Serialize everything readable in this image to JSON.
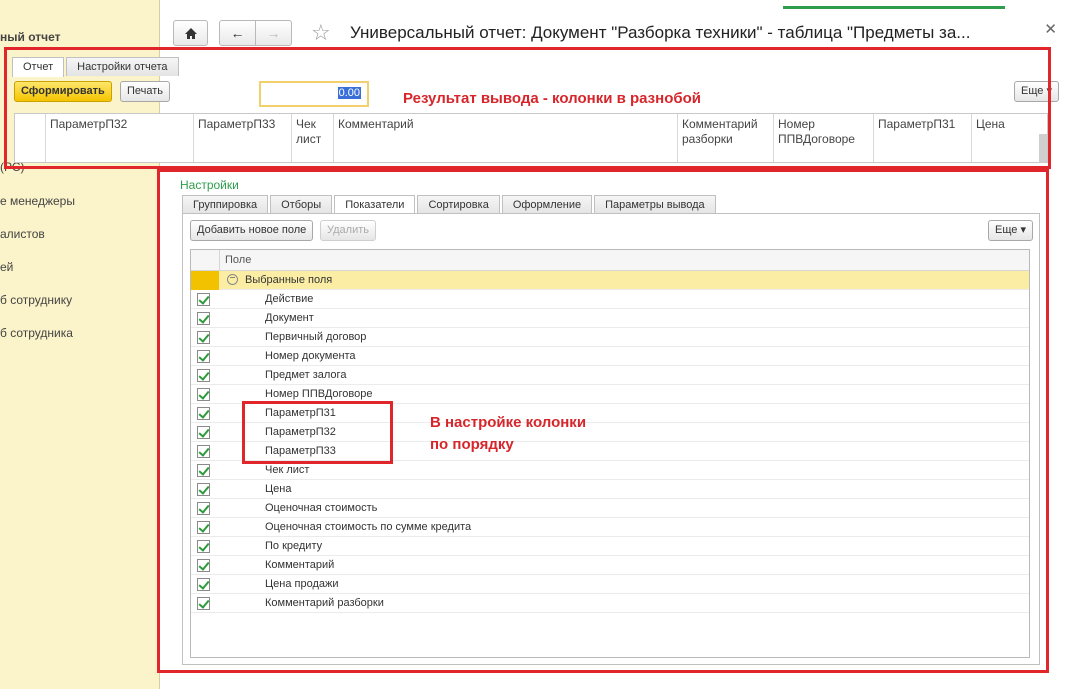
{
  "sidebar": {
    "title": "ный отчет",
    "items": [
      "(РС)",
      "е менеджеры",
      "алистов",
      "ей",
      "б сотруднику",
      "б сотрудника"
    ]
  },
  "header": {
    "home_icon": "home-icon",
    "back_icon": "arrow-left-icon",
    "forward_icon": "arrow-right-icon",
    "favorite_icon": "star-icon",
    "title": "Универсальный отчет: Документ \"Разборка техники\" - таблица \"Предметы за...",
    "close_icon": "close-icon"
  },
  "report": {
    "tabs": [
      "Отчет",
      "Настройки отчета"
    ],
    "generate_button": "Сформировать",
    "print_button": "Печать",
    "amount_value": "0.00",
    "more_button": "Еще ▾",
    "columns": [
      "ПараметрП32",
      "ПараметрП33",
      "Чек лист",
      "Комментарий",
      "Комментарий разборки",
      "Номер ППВДоговоре",
      "ПараметрП31",
      "Цена"
    ]
  },
  "annotations": {
    "result": "Результат вывода - колонки в разнобой",
    "settings_line1": "В настройке колонки",
    "settings_line2": "по порядку"
  },
  "settings": {
    "label": "Настройки",
    "tabs": [
      "Группировка",
      "Отборы",
      "Показатели",
      "Сортировка",
      "Оформление",
      "Параметры вывода"
    ],
    "add_button": "Добавить новое поле",
    "delete_button": "Удалить",
    "more_button": "Еще ▾",
    "field_header": "Поле",
    "group_label": "Выбранные поля",
    "fields": [
      "Действие",
      "Документ",
      "Первичный договор",
      "Номер документа",
      "Предмет залога",
      "Номер ППВДоговоре",
      "ПараметрП31",
      "ПараметрП32",
      "ПараметрП33",
      "Чек лист",
      "Цена",
      "Оценочная стоимость",
      "Оценочная стоимость по сумме кредита",
      "По кредиту",
      "Комментарий",
      "Цена продажи",
      "Комментарий разборки"
    ]
  },
  "colors": {
    "accent_yellow": "#f5c400",
    "annotation_red": "#e0262b",
    "settings_green": "#2e9e4c"
  }
}
